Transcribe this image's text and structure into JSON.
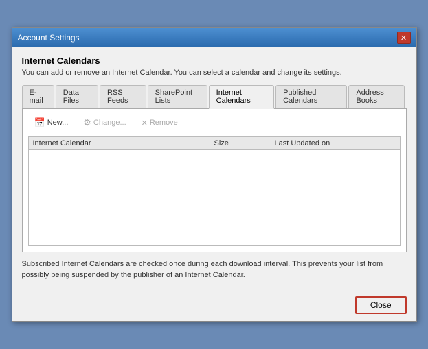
{
  "window": {
    "title": "Account Settings",
    "close_icon": "✕"
  },
  "section": {
    "title": "Internet Calendars",
    "description": "You can add or remove an Internet Calendar. You can select a calendar and change its settings."
  },
  "tabs": [
    {
      "label": "E-mail",
      "active": false
    },
    {
      "label": "Data Files",
      "active": false
    },
    {
      "label": "RSS Feeds",
      "active": false
    },
    {
      "label": "SharePoint Lists",
      "active": false
    },
    {
      "label": "Internet Calendars",
      "active": true
    },
    {
      "label": "Published Calendars",
      "active": false
    },
    {
      "label": "Address Books",
      "active": false
    }
  ],
  "toolbar": {
    "new_label": "New...",
    "change_label": "Change...",
    "remove_label": "Remove"
  },
  "list": {
    "columns": [
      "Internet Calendar",
      "Size",
      "Last Updated on"
    ],
    "rows": []
  },
  "bottom_text": "Subscribed Internet Calendars are checked once during each download interval. This prevents your list from possibly being suspended by the publisher of an Internet Calendar.",
  "footer": {
    "close_label": "Close"
  }
}
